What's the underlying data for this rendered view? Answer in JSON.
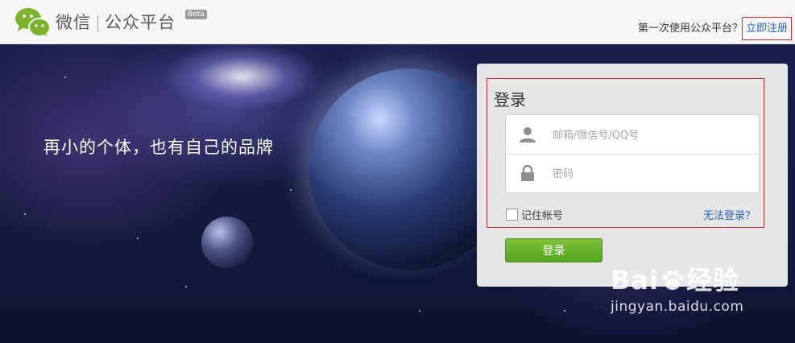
{
  "header": {
    "brand_wechat": "微信",
    "brand_platform": "公众平台",
    "beta": "Beta",
    "first_time_text": "第一次使用公众平台？",
    "register_link": "立即注册"
  },
  "hero": {
    "slogan": "再小的个体，也有自己的品牌"
  },
  "login": {
    "title": "登录",
    "account_placeholder": "邮箱/微信号/QQ号",
    "password_placeholder": "密码",
    "remember_label": "记住帐号",
    "cant_login_link": "无法登录？",
    "submit_label": "登录"
  },
  "watermark": {
    "logo_left": "Bai",
    "logo_right": "经验",
    "url": "jingyan.baidu.com"
  },
  "colors": {
    "accent_green": "#55a61f",
    "link_blue": "#2a5fb0",
    "highlight_red": "#c73030"
  }
}
